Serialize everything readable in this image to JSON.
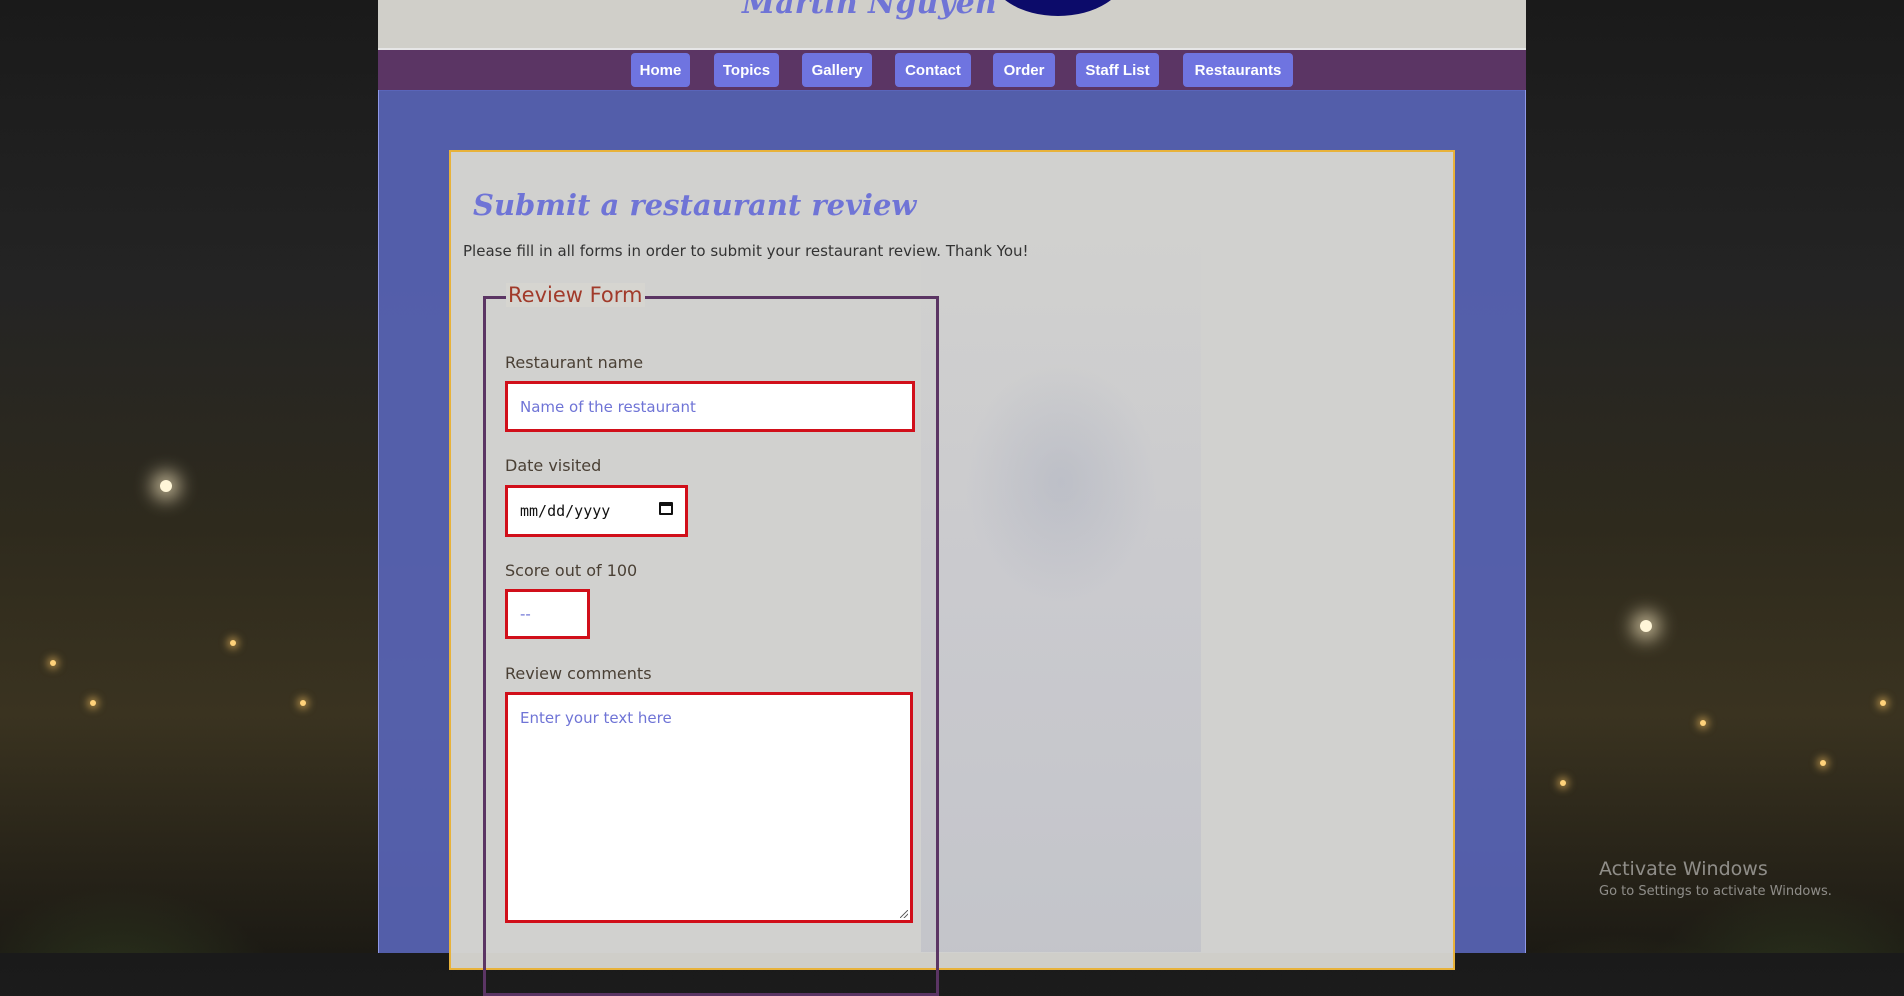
{
  "header": {
    "site_name": "Martin Nguyen"
  },
  "nav": {
    "items": [
      {
        "label": "Home"
      },
      {
        "label": "Topics"
      },
      {
        "label": "Gallery"
      },
      {
        "label": "Contact"
      },
      {
        "label": "Order"
      },
      {
        "label": "Staff List"
      },
      {
        "label": "Restaurants"
      }
    ]
  },
  "review": {
    "title": "Submit a restaurant review",
    "description": "Please fill in all forms in order to submit your restaurant review. Thank You!",
    "form": {
      "legend": "Review Form",
      "restaurant_name": {
        "label": "Restaurant name",
        "placeholder": "Name of the restaurant"
      },
      "date_visited": {
        "label": "Date visited",
        "value": "mm/dd/yyyy"
      },
      "score": {
        "label": "Score out of 100",
        "placeholder": "--"
      },
      "comments": {
        "label": "Review comments",
        "placeholder": "Enter your text here"
      }
    }
  },
  "system": {
    "activation_title": "Activate Windows",
    "activation_sub": "Go to Settings to activate Windows."
  },
  "colors": {
    "accent": "#6f74d6",
    "nav_bar": "#5b3564",
    "field_border": "#d10f1a",
    "card_border": "#e8b23a"
  }
}
